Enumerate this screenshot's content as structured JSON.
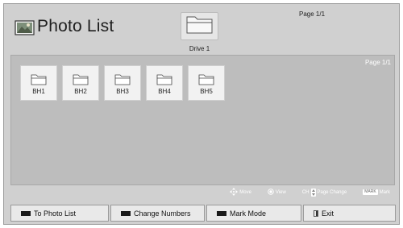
{
  "header": {
    "title": "Photo List",
    "page_info": "Page 1/1",
    "drive_label": "Drive 1"
  },
  "content": {
    "page_info": "Page 1/1",
    "folders": [
      {
        "label": "BH1"
      },
      {
        "label": "BH2"
      },
      {
        "label": "BH3"
      },
      {
        "label": "BH4"
      },
      {
        "label": "BH5"
      }
    ]
  },
  "hints": {
    "move": "Move",
    "view": "View",
    "ch": "CH",
    "page_change": "Page Change",
    "mark_badge": "MARK",
    "mark": "Mark"
  },
  "buttons": {
    "to_photo_list": "To Photo List",
    "change_numbers": "Change Numbers",
    "mark_mode": "Mark Mode",
    "exit": "Exit"
  },
  "icons": {
    "title": "photo-album-icon",
    "drive": "folder-icon",
    "folder": "folder-icon",
    "move": "four-way-arrow-icon",
    "view": "ok-button-icon",
    "exit": "exit-icon"
  },
  "colors": {
    "background": "#d0d0d0",
    "content": "#bdbdbd",
    "button": "#e9e9e9",
    "color_key": "#1a1a1a"
  }
}
